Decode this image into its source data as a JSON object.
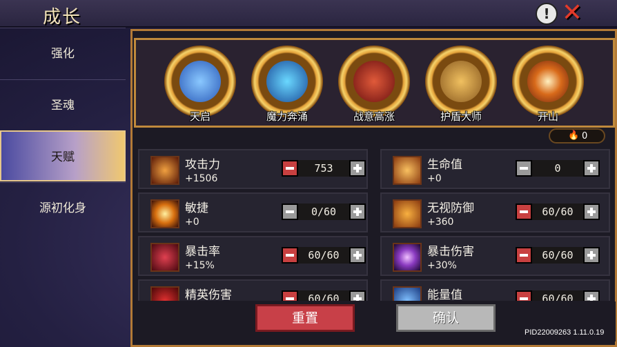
{
  "header": {
    "title": "成长"
  },
  "sidebar": {
    "items": [
      {
        "label": "强化"
      },
      {
        "label": "圣魂"
      },
      {
        "label": "天赋"
      },
      {
        "label": "源初化身"
      }
    ]
  },
  "talents": [
    {
      "label": "天启",
      "icon": "meditating-figure-icon",
      "color": "#3a7ad8"
    },
    {
      "label": "魔力奔涌",
      "icon": "mana-swirl-icon",
      "color": "#2a9ae0"
    },
    {
      "label": "战意高涨",
      "icon": "crimson-rage-icon",
      "color": "#b02a2a"
    },
    {
      "label": "护盾大师",
      "icon": "shield-icon",
      "color": "#c88a3a"
    },
    {
      "label": "开山",
      "icon": "burst-icon",
      "color": "#d86a1a"
    }
  ],
  "points": {
    "value": "0"
  },
  "stats": [
    {
      "name": "攻击力",
      "bonus": "+1506",
      "value": "753",
      "icon": "sword-icon",
      "icon_color": "#c8701a",
      "minus_enabled": true
    },
    {
      "name": "生命值",
      "bonus": "+0",
      "value": "0",
      "icon": "heart-icon",
      "icon_color": "#e8902a",
      "minus_enabled": false
    },
    {
      "name": "敏捷",
      "bonus": "+0",
      "value": "0/60",
      "icon": "sun-icon",
      "icon_color": "#e8a020",
      "minus_enabled": false
    },
    {
      "name": "无视防御",
      "bonus": "+360",
      "value": "60/60",
      "icon": "broken-shield-icon",
      "icon_color": "#e07a1a",
      "minus_enabled": true
    },
    {
      "name": "暴击率",
      "bonus": "+15%",
      "value": "60/60",
      "icon": "red-vortex-icon",
      "icon_color": "#a02030",
      "minus_enabled": true
    },
    {
      "name": "暴击伤害",
      "bonus": "+30%",
      "value": "60/60",
      "icon": "purple-orb-icon",
      "icon_color": "#8a3ac0",
      "minus_enabled": true
    },
    {
      "name": "精英伤害",
      "bonus": "",
      "value": "60/60",
      "icon": "dragon-icon",
      "icon_color": "#c02020",
      "minus_enabled": true
    },
    {
      "name": "能量值",
      "bonus": "",
      "value": "60/60",
      "icon": "energy-icon",
      "icon_color": "#3a7ae0",
      "minus_enabled": true
    }
  ],
  "buttons": {
    "reset": "重置",
    "confirm": "确认"
  },
  "version": "PID22009263 1.11.0.19"
}
